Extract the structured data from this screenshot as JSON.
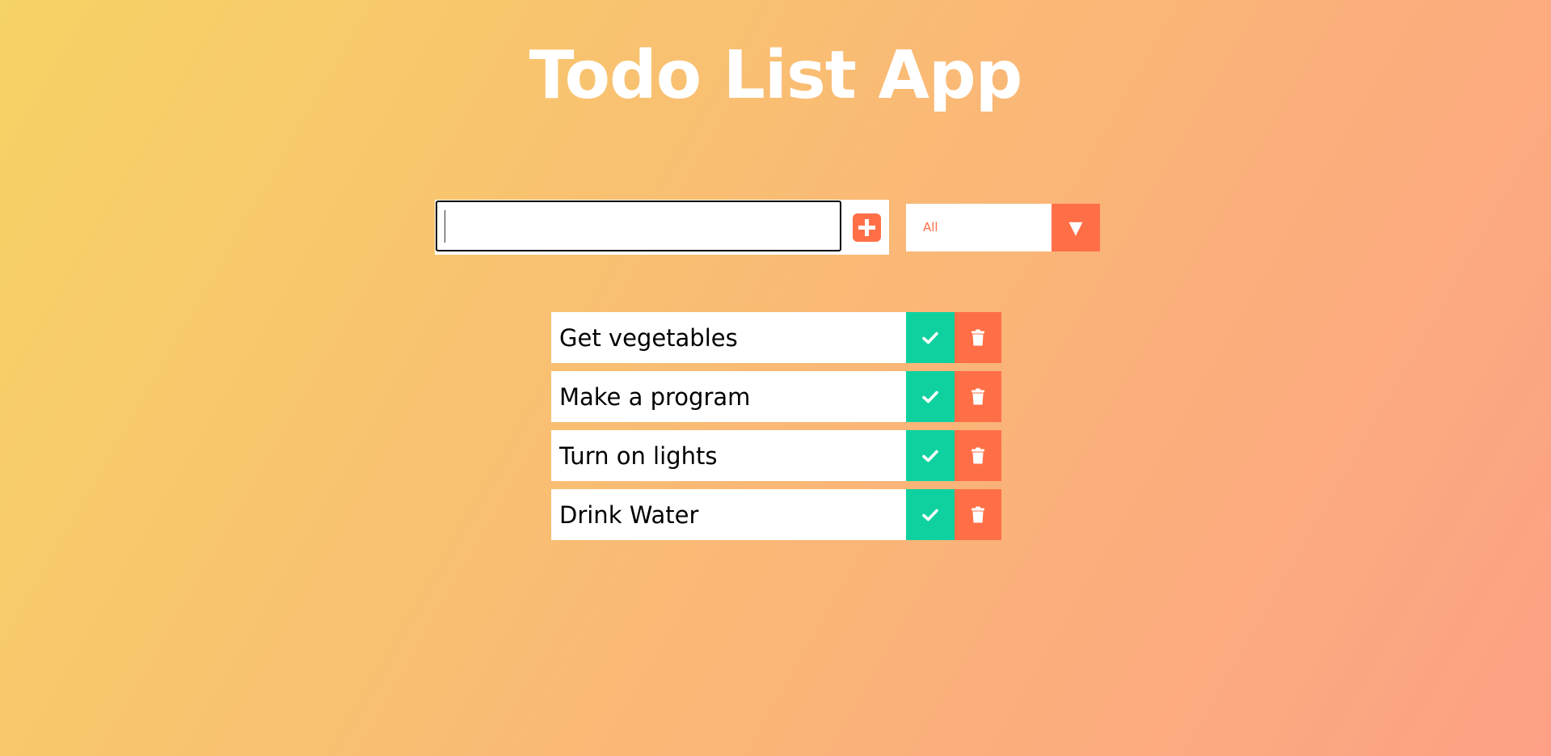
{
  "header": {
    "title": "Todo List App"
  },
  "input": {
    "value": "",
    "placeholder": ""
  },
  "filter": {
    "selected": "All",
    "arrow": "▼"
  },
  "todos": [
    {
      "text": "Get vegetables"
    },
    {
      "text": "Make a program"
    },
    {
      "text": "Turn on lights"
    },
    {
      "text": "Drink Water"
    }
  ],
  "icons": {
    "add": "plus-square-icon",
    "complete": "check-icon",
    "delete": "trash-icon"
  },
  "colors": {
    "gradient_start": "#f6d365",
    "gradient_end": "#fda085",
    "accent": "#ff6f47",
    "complete": "#0fd1a0"
  }
}
